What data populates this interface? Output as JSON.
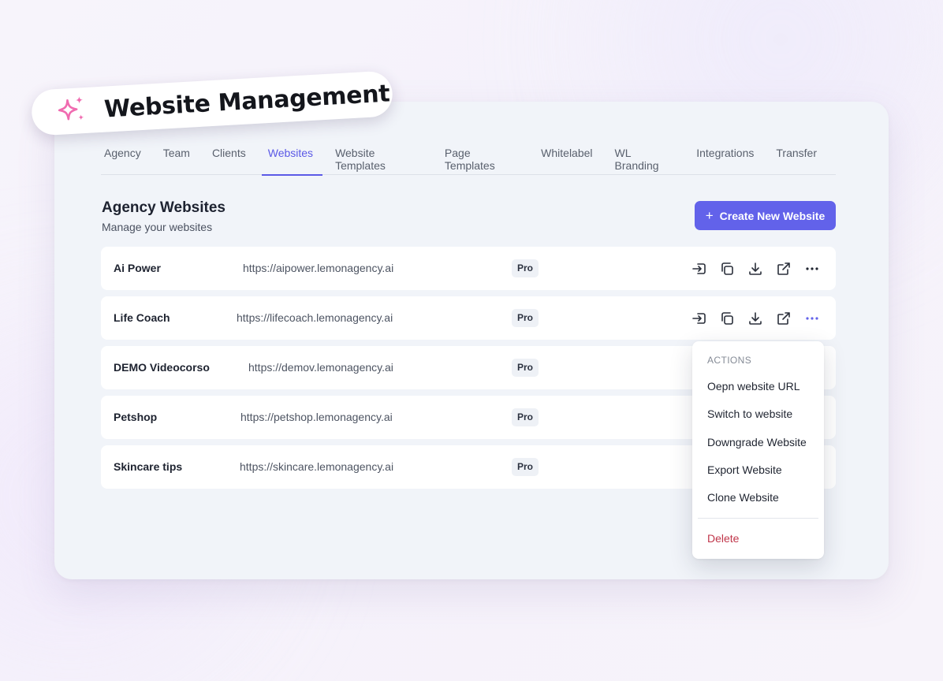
{
  "banner": {
    "title": "Website Management",
    "icon": "sparkles-icon"
  },
  "tabs": [
    {
      "label": "Agency"
    },
    {
      "label": "Team"
    },
    {
      "label": "Clients"
    },
    {
      "label": "Websites",
      "active": true
    },
    {
      "label": "Website Templates"
    },
    {
      "label": "Page Templates"
    },
    {
      "label": "Whitelabel"
    },
    {
      "label": "WL Branding"
    },
    {
      "label": "Integrations"
    },
    {
      "label": "Transfer"
    }
  ],
  "section": {
    "title": "Agency Websites",
    "subtitle": "Manage your websites"
  },
  "create_button": {
    "label": "Create New Website",
    "icon": "plus-icon"
  },
  "websites": [
    {
      "name": "Ai Power",
      "url": "https://aipower.lemonagency.ai",
      "plan": "Pro"
    },
    {
      "name": "Life Coach",
      "url": "https://lifecoach.lemonagency.ai",
      "plan": "Pro"
    },
    {
      "name": "DEMO Videocorso",
      "url": "https://demov.lemonagency.ai",
      "plan": "Pro"
    },
    {
      "name": "Petshop",
      "url": "https://petshop.lemonagency.ai",
      "plan": "Pro"
    },
    {
      "name": "Skincare tips",
      "url": "https://skincare.lemonagency.ai",
      "plan": "Pro"
    }
  ],
  "row_actions": [
    "switch-icon",
    "copy-icon",
    "download-icon",
    "external-link-icon",
    "more-icon"
  ],
  "actions_menu": {
    "header": "ACTIONS",
    "items": [
      "Oepn website URL",
      "Switch to website",
      "Downgrade Website",
      "Export Website",
      "Clone Website"
    ],
    "danger_item": "Delete"
  },
  "colors": {
    "accent": "#6262ea",
    "danger": "#c0364a",
    "sparkle": "#f06bb0"
  }
}
